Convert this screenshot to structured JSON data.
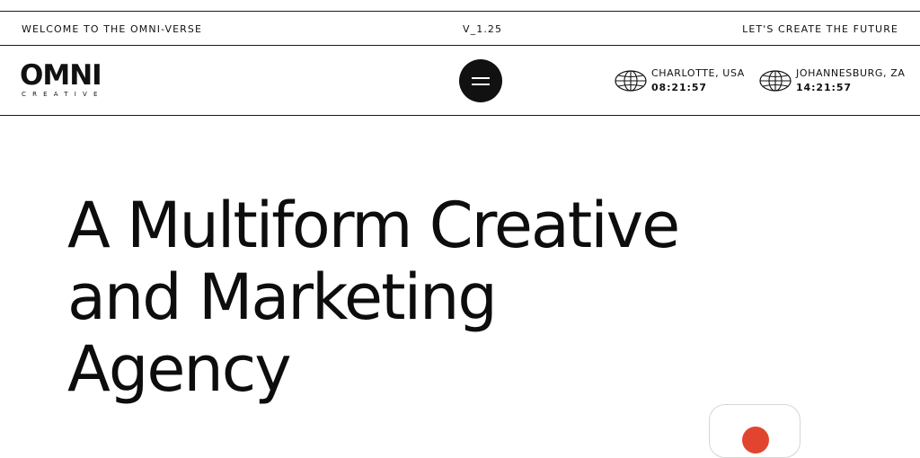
{
  "topbar": {
    "left": "WELCOME TO THE OMNI-VERSE",
    "center": "V_1.25",
    "right": "LET'S CREATE THE FUTURE"
  },
  "logo": {
    "word": "OMNI",
    "sub": "CREATIVE"
  },
  "menu": {
    "icon": "hamburger-icon"
  },
  "clocks": [
    {
      "city": "CHARLOTTE, USA",
      "time": "08:21:57",
      "icon": "globe-icon"
    },
    {
      "city": "JOHANNESBURG, ZA",
      "time": "14:21:57",
      "icon": "globe-icon"
    }
  ],
  "hero": {
    "lines": [
      "A Multiform Creative",
      "and Marketing",
      "Agency"
    ]
  },
  "colors": {
    "text": "#111111",
    "background": "#ffffff",
    "accent": "#e2452f"
  }
}
